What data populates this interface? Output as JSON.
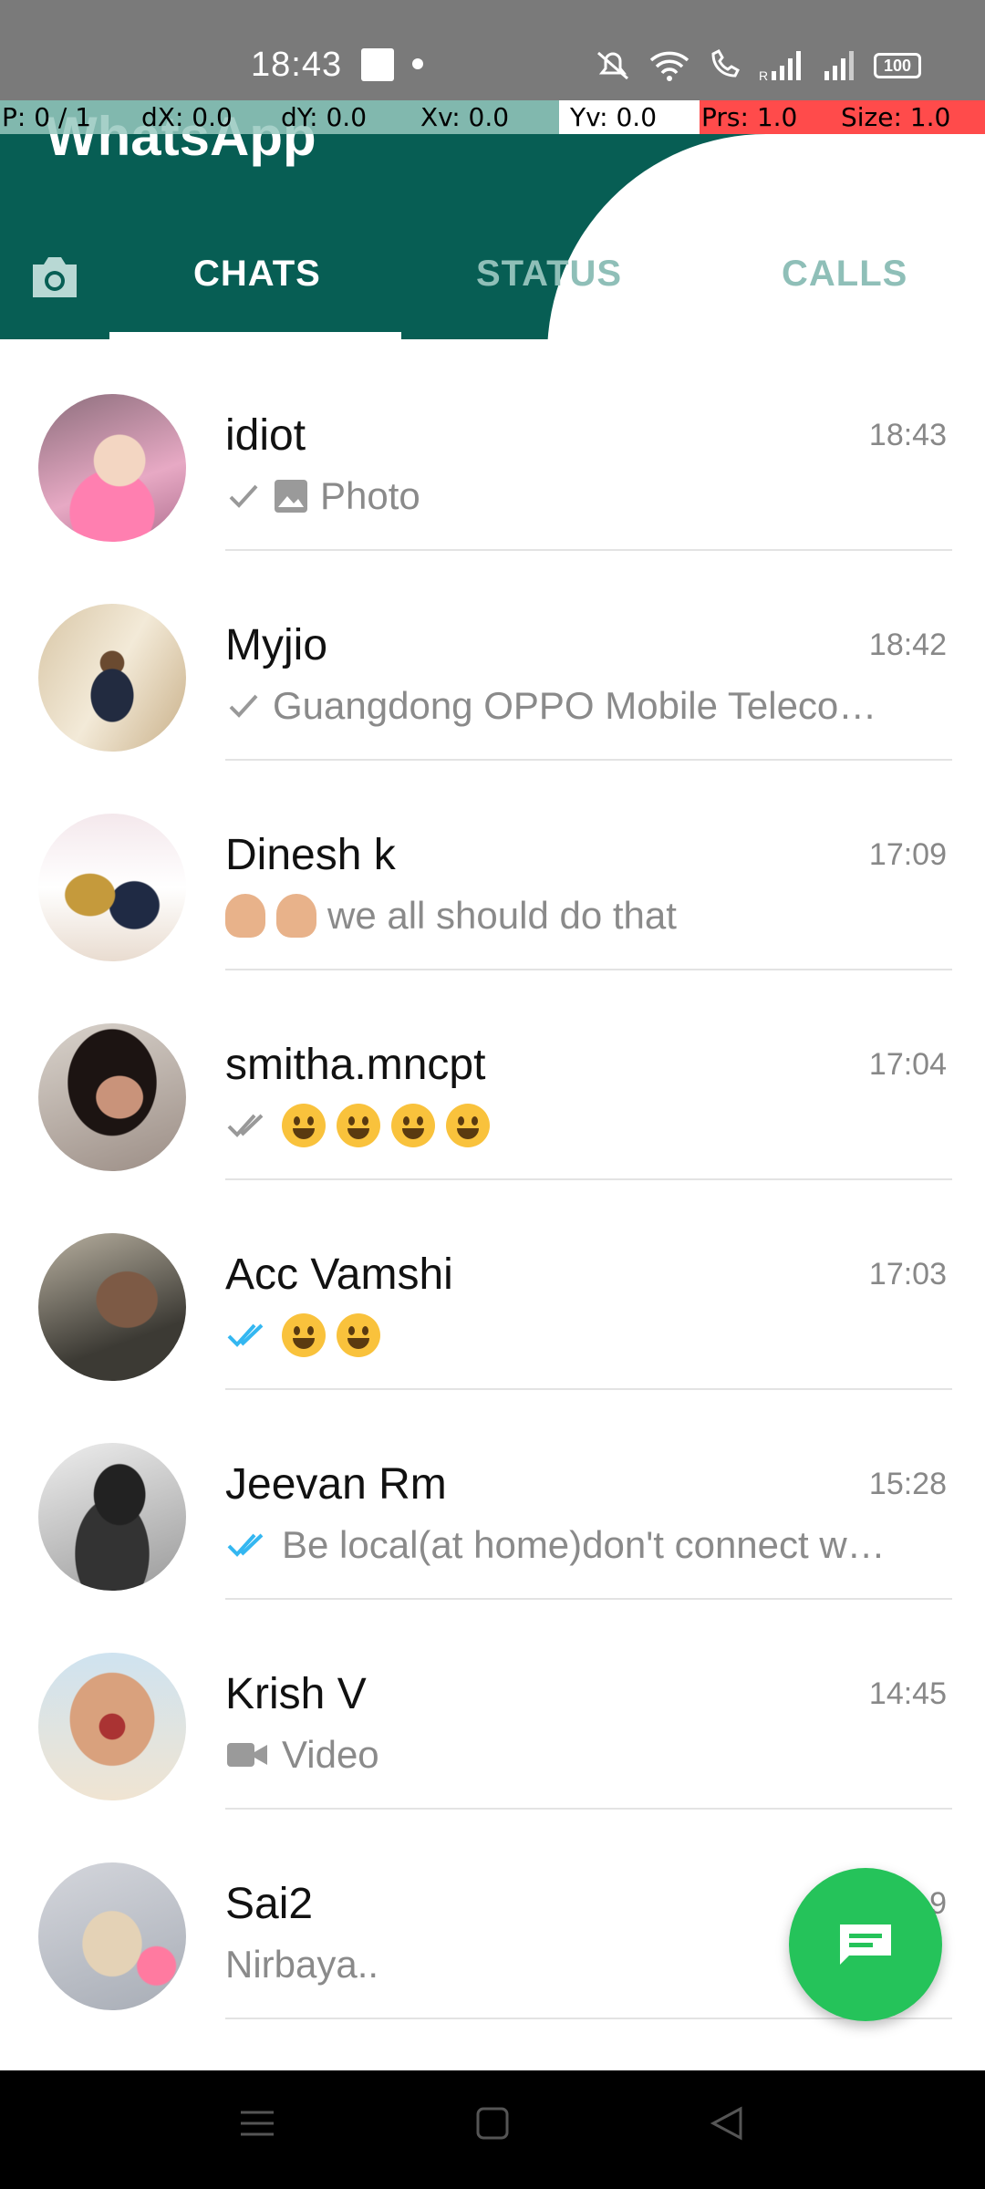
{
  "status_bar": {
    "time": "18:43",
    "battery": "100"
  },
  "debug_overlay": {
    "p": "P: 0 / 1",
    "dx": "dX: 0.0",
    "dy": "dY: 0.0",
    "xv": "Xv: 0.0",
    "yv": "Yv: 0.0",
    "prs": "Prs: 1.0",
    "size": "Size: 1.0"
  },
  "header": {
    "title": "WhatsApp",
    "tabs": [
      "CHATS",
      "STATUS",
      "CALLS"
    ],
    "active_tab": "CHATS"
  },
  "chats": [
    {
      "name": "idiot",
      "time": "18:43",
      "preview": "Photo",
      "status": "sent",
      "kind": "photo"
    },
    {
      "name": "Myjio",
      "time": "18:42",
      "preview": "Guangdong OPPO Mobile Teleco…",
      "status": "sent",
      "kind": "text"
    },
    {
      "name": "Dinesh k",
      "time": "17:09",
      "preview": "we all should do that",
      "status": "none",
      "kind": "hands"
    },
    {
      "name": "smitha.mncpt",
      "time": "17:04",
      "preview": "",
      "status": "delivered",
      "kind": "emoji4"
    },
    {
      "name": "Acc Vamshi",
      "time": "17:03",
      "preview": "",
      "status": "read",
      "kind": "emoji2"
    },
    {
      "name": "Jeevan Rm",
      "time": "15:28",
      "preview": "Be local(at home)don't connect w…",
      "status": "read",
      "kind": "text"
    },
    {
      "name": "Krish V",
      "time": "14:45",
      "preview": "Video",
      "status": "none",
      "kind": "video"
    },
    {
      "name": "Sai2",
      "time": "…9",
      "preview": "Nirbaya..",
      "status": "none",
      "kind": "text"
    }
  ],
  "colors": {
    "header": "#075e54",
    "fab": "#25c35a",
    "read_tick": "#34b7f1"
  },
  "icons": {
    "camera": "camera-icon",
    "fab": "new-chat-icon",
    "nav": [
      "menu-icon",
      "home-icon",
      "back-icon"
    ]
  }
}
